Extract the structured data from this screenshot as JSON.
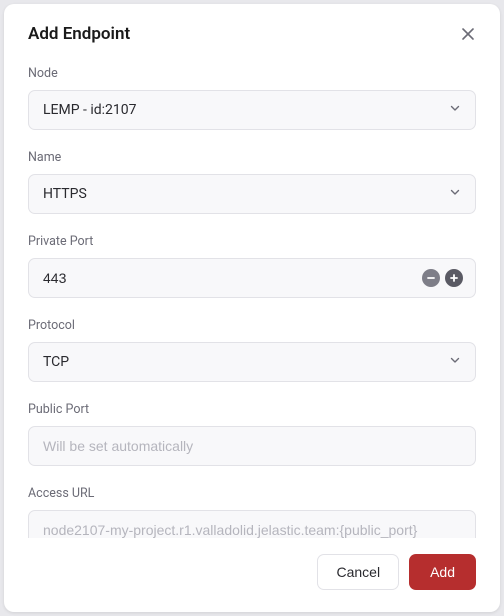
{
  "dialog": {
    "title": "Add Endpoint",
    "fields": {
      "node": {
        "label": "Node",
        "value": "LEMP - id:2107"
      },
      "name": {
        "label": "Name",
        "value": "HTTPS"
      },
      "privatePort": {
        "label": "Private Port",
        "value": "443"
      },
      "protocol": {
        "label": "Protocol",
        "value": "TCP"
      },
      "publicPort": {
        "label": "Public Port",
        "placeholder": "Will be set automatically"
      },
      "accessUrl": {
        "label": "Access URL",
        "placeholder": "node2107-my-project.r1.valladolid.jelastic.team:{public_port}"
      }
    },
    "buttons": {
      "cancel": "Cancel",
      "add": "Add"
    }
  }
}
